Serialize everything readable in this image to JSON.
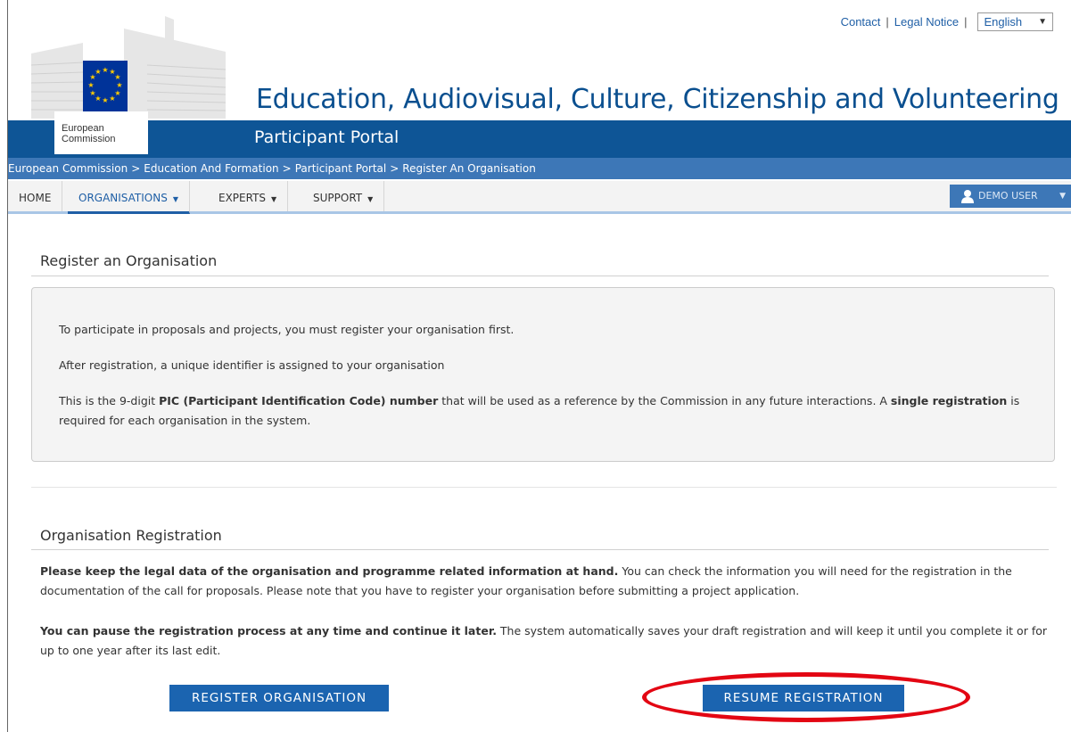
{
  "header": {
    "links": [
      "Contact",
      "Legal Notice"
    ],
    "language": "English",
    "site_title": "Education, Audiovisual, Culture, Citizenship and Volunteering",
    "portal_title": "Participant Portal",
    "logo_text_line1": "European",
    "logo_text_line2": "Commission"
  },
  "breadcrumb": [
    "European Commission",
    "Education And Formation",
    "Participant Portal",
    "Register An Organisation"
  ],
  "nav": {
    "items": [
      "HOME",
      "ORGANISATIONS",
      "EXPERTS",
      "SUPPORT"
    ],
    "active": "ORGANISATIONS",
    "user": "DEMO USER"
  },
  "intro": {
    "title": "Register an Organisation",
    "p1": "To participate in proposals and projects, you must register your organisation first.",
    "p2": "After registration, a unique identifier is assigned to your organisation",
    "p3_a": "This is the 9-digit ",
    "p3_b": "PIC (Participant Identification Code) number",
    "p3_c": " that will be used as a reference by the Commission in any future interactions. A ",
    "p3_d": "single registration",
    "p3_e": " is required for each organisation in the system."
  },
  "registration": {
    "title": "Organisation Registration",
    "p1_bold": "Please keep the legal data of the organisation and programme related information at hand.",
    "p1_rest": " You can check the information you will need for the registration in the documentation of the call for proposals. Please note that you have to register your organisation before submitting a project application.",
    "p2_bold": "You can pause the registration process at any time and continue it later.",
    "p2_rest": " The system automatically saves your draft registration and will keep it until you complete it or for up to one year after its last edit.",
    "register_button": "REGISTER ORGANISATION",
    "resume_button": "RESUME REGISTRATION"
  },
  "colors": {
    "band_blue": "#0e5596",
    "breadcrumb_blue": "#3d77b7",
    "button_blue": "#1b64b0",
    "highlight_red": "#e30613"
  }
}
